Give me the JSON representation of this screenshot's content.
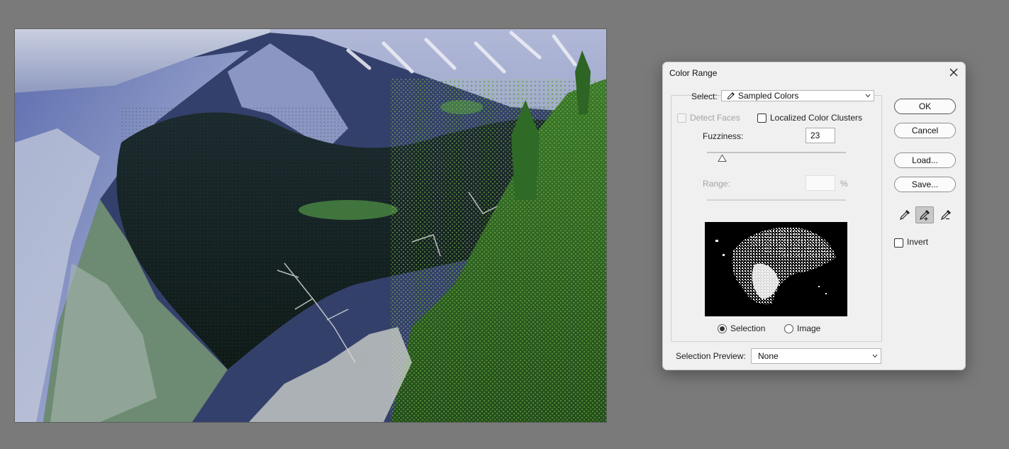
{
  "dialog": {
    "title": "Color Range",
    "select_label": "Select:",
    "select_value": "Sampled Colors",
    "detect_faces_label": "Detect Faces",
    "localized_label": "Localized Color Clusters",
    "fuzziness_label": "Fuzziness:",
    "fuzziness_value": "23",
    "fuzziness_level_pct": 11,
    "range_label": "Range:",
    "range_value": "",
    "range_unit": "%",
    "radio_selection_label": "Selection",
    "radio_image_label": "Image",
    "preview_mode": "Selection",
    "selection_preview_label": "Selection Preview:",
    "selection_preview_value": "None",
    "ok_label": "OK",
    "cancel_label": "Cancel",
    "load_label": "Load...",
    "save_label": "Save...",
    "invert_label": "Invert",
    "active_tool": "eyedropper-plus-icon"
  },
  "colors": {
    "workspace": "#7a7a7a",
    "dialog_bg": "#f0f0f0",
    "active_tool_bg": "#c8c8c8"
  }
}
